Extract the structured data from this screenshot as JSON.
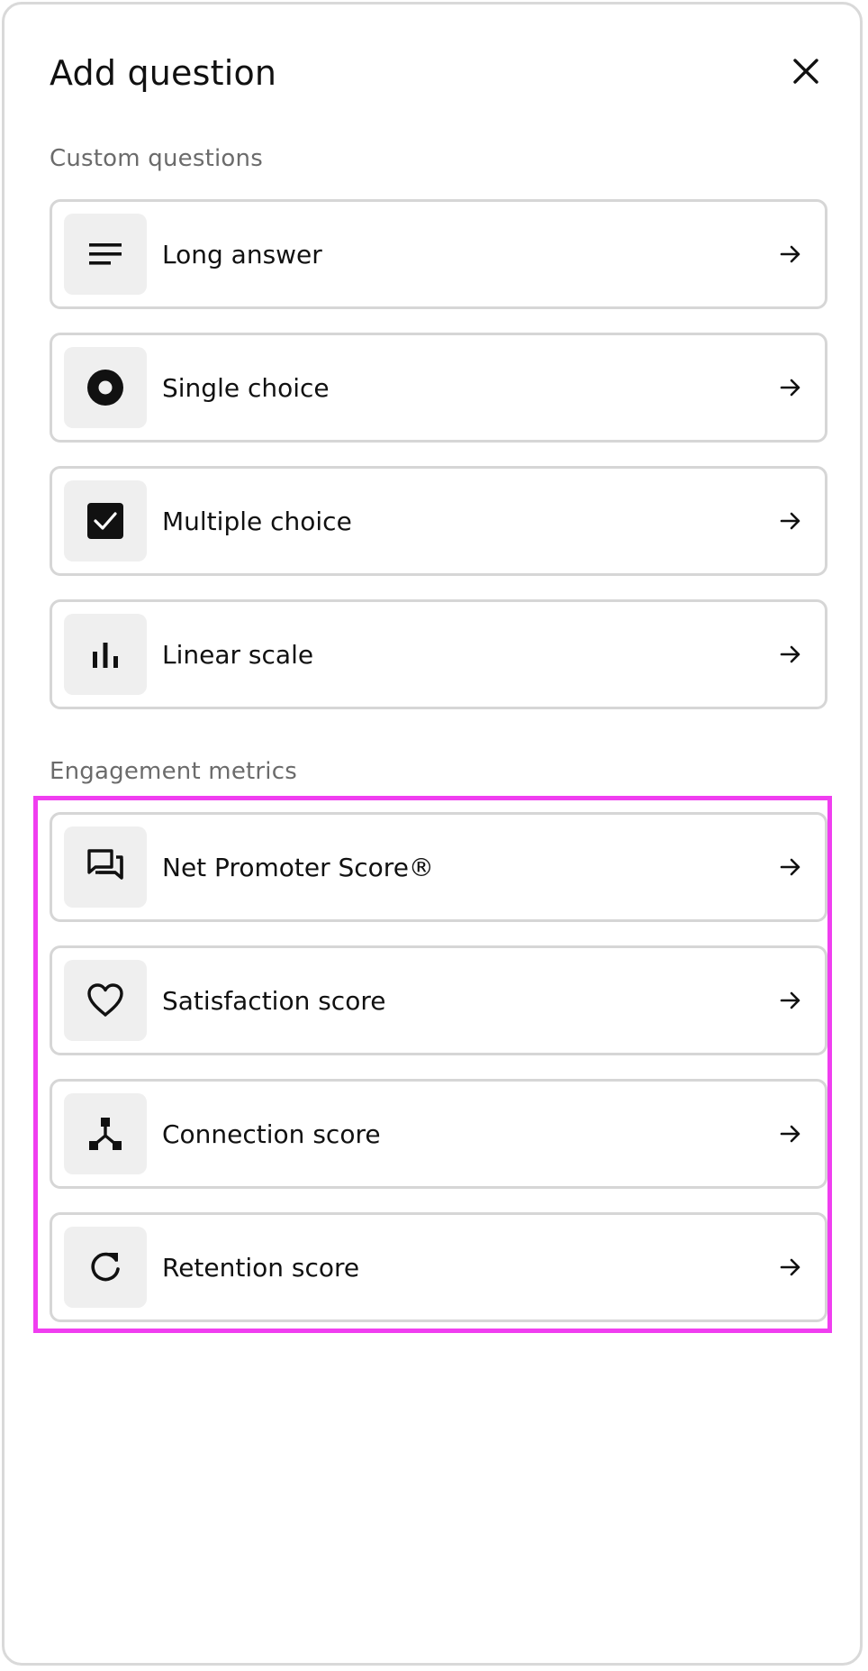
{
  "dialog": {
    "title": "Add question"
  },
  "sections": {
    "custom": {
      "label": "Custom questions",
      "items": [
        {
          "label": "Long answer",
          "icon": "long-answer-icon"
        },
        {
          "label": "Single choice",
          "icon": "radio-icon"
        },
        {
          "label": "Multiple choice",
          "icon": "checkbox-icon"
        },
        {
          "label": "Linear scale",
          "icon": "bar-chart-icon"
        }
      ]
    },
    "engagement": {
      "label": "Engagement metrics",
      "items": [
        {
          "label": "Net Promoter Score®",
          "icon": "chat-bubbles-icon"
        },
        {
          "label": "Satisfaction score",
          "icon": "heart-icon"
        },
        {
          "label": "Connection score",
          "icon": "network-icon"
        },
        {
          "label": "Retention score",
          "icon": "refresh-icon"
        }
      ]
    }
  },
  "colors": {
    "highlight": "#f03ef0",
    "icon_bg": "#efefef",
    "border": "#d6d6d6"
  }
}
